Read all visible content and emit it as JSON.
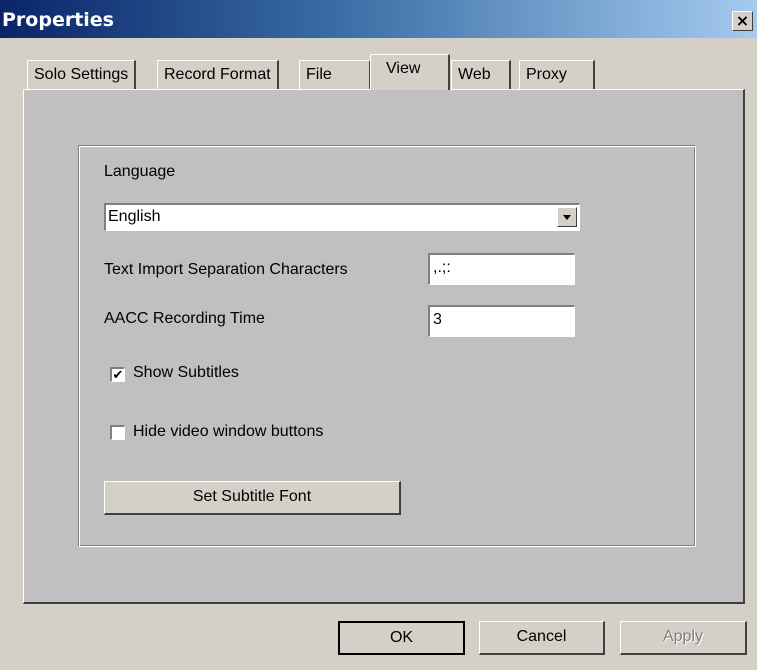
{
  "window": {
    "title": "Properties",
    "close_label": "×"
  },
  "tabs": [
    {
      "label": "Solo Settings"
    },
    {
      "label": "Record Format"
    },
    {
      "label": "File"
    },
    {
      "label": "View",
      "active": true
    },
    {
      "label": "Web"
    },
    {
      "label": "Proxy"
    }
  ],
  "view": {
    "language_label": "Language",
    "language_value": "English",
    "separation_label": "Text Import Separation Characters",
    "separation_value": ",.;:",
    "aacc_label": "AACC Recording Time",
    "aacc_value": "3",
    "show_subtitles_label": "Show Subtitles",
    "show_subtitles_checked": true,
    "hide_buttons_label": "Hide video window buttons",
    "hide_buttons_checked": false,
    "set_font_label": "Set Subtitle Font"
  },
  "footer": {
    "ok_label": "OK",
    "cancel_label": "Cancel",
    "apply_label": "Apply"
  },
  "check_mark": "✔"
}
